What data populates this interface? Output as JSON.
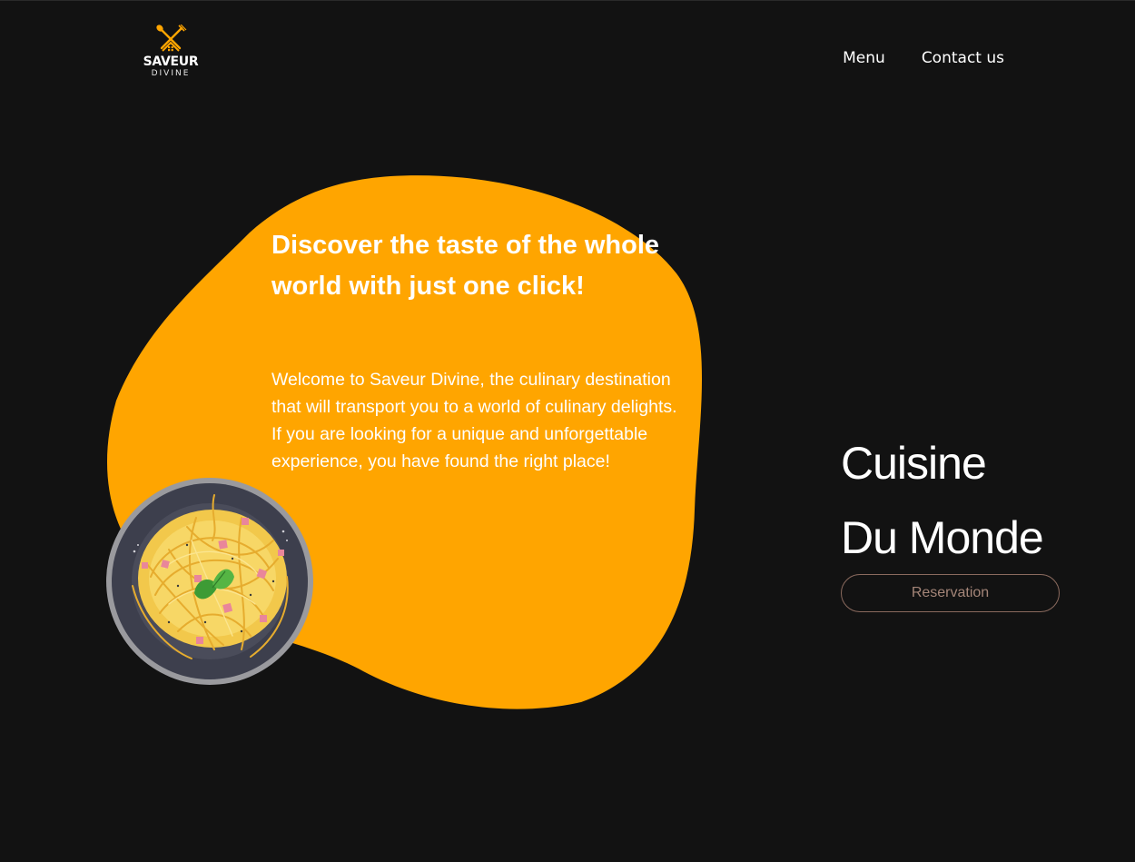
{
  "brand": {
    "name": "SAVEUR",
    "subtitle": "DIVINE",
    "accent_color": "#FFA500",
    "logo_icon": "fork-spoon-roof-icon"
  },
  "nav": {
    "items": [
      {
        "label": "Menu"
      },
      {
        "label": "Contact us"
      }
    ]
  },
  "hero": {
    "title": "Discover the taste of the whole world with just one click!",
    "text": "Welcome to Saveur Divine, the culinary destination that will transport you to a world of culinary delights. If you are looking for a unique and unforgettable experience, you have found the right place!",
    "image": "spaghetti-plate-icon"
  },
  "tagline": {
    "line1": "Cuisine",
    "line2": "Du Monde"
  },
  "reservation": {
    "label": "Reservation",
    "border_color": "#8A6A5E"
  },
  "colors": {
    "background": "#121212",
    "blob": "#FFA500",
    "text": "#FFFFFF"
  }
}
